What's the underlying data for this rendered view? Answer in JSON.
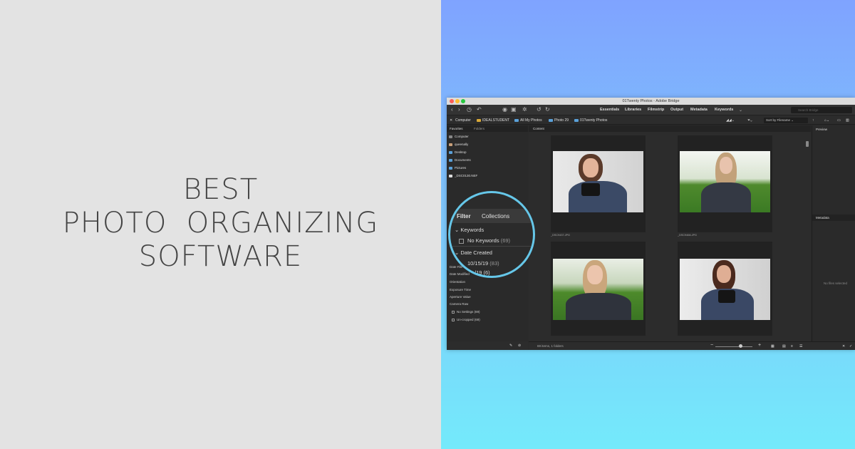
{
  "headline": [
    "BEST",
    "PHOTO  ORGANIZING",
    "SOFTWARE"
  ],
  "window": {
    "title": "01Twenty Photos - Adobe Bridge",
    "workspaces": [
      "Essentials",
      "Libraries",
      "Filmstrip",
      "Output",
      "Metadata",
      "Keywords"
    ],
    "search_placeholder": "Search Bridge",
    "breadcrumb": [
      "Computer",
      "IDEALSTUDENT",
      "All My Photos",
      "Photo 29",
      "01Twenty Photos"
    ],
    "sort_label": "Sort by Filename",
    "left_tabs": [
      "Favorites",
      "Folders"
    ],
    "favorites": [
      "Computer",
      "queenally",
      "Desktop",
      "Documents",
      "Pictures",
      "_DSC0130.NEF"
    ],
    "filter_items": [
      {
        "label": "Date File Created",
        "checkbox": false
      },
      {
        "label": "Date Modified",
        "checkbox": false
      },
      {
        "label": "Orientation",
        "checkbox": false
      },
      {
        "label": "Exposure Time",
        "checkbox": false
      },
      {
        "label": "Aperture Value",
        "checkbox": false
      },
      {
        "label": "Camera Raw",
        "checkbox": false
      },
      {
        "label": "No Settings (69)",
        "checkbox": true
      },
      {
        "label": "Un-cropped (69)",
        "checkbox": true
      }
    ],
    "content_label": "Content",
    "thumb_names": [
      "_DSC9437.JPG",
      "_DSC9466.JPG"
    ],
    "status": "69 items, 1 folders",
    "right_tabs": {
      "preview": "Preview",
      "metadata": "Metadata"
    },
    "no_file": "No files selected"
  },
  "magnifier": {
    "tabs": [
      "Filter",
      "Collections"
    ],
    "keywords": "Keywords",
    "no_keywords": "No Keywords",
    "no_keywords_count": "(69)",
    "date_created": "Date Created",
    "date_value": "10/15/19",
    "date_count": "(83)",
    "partial_line": "/19  (6)"
  },
  "colors": {
    "accent_ring": "#66c7e9",
    "gradient_top": "#7fa3ff",
    "gradient_bottom": "#74eafb",
    "left_bg": "#e3e3e3"
  }
}
